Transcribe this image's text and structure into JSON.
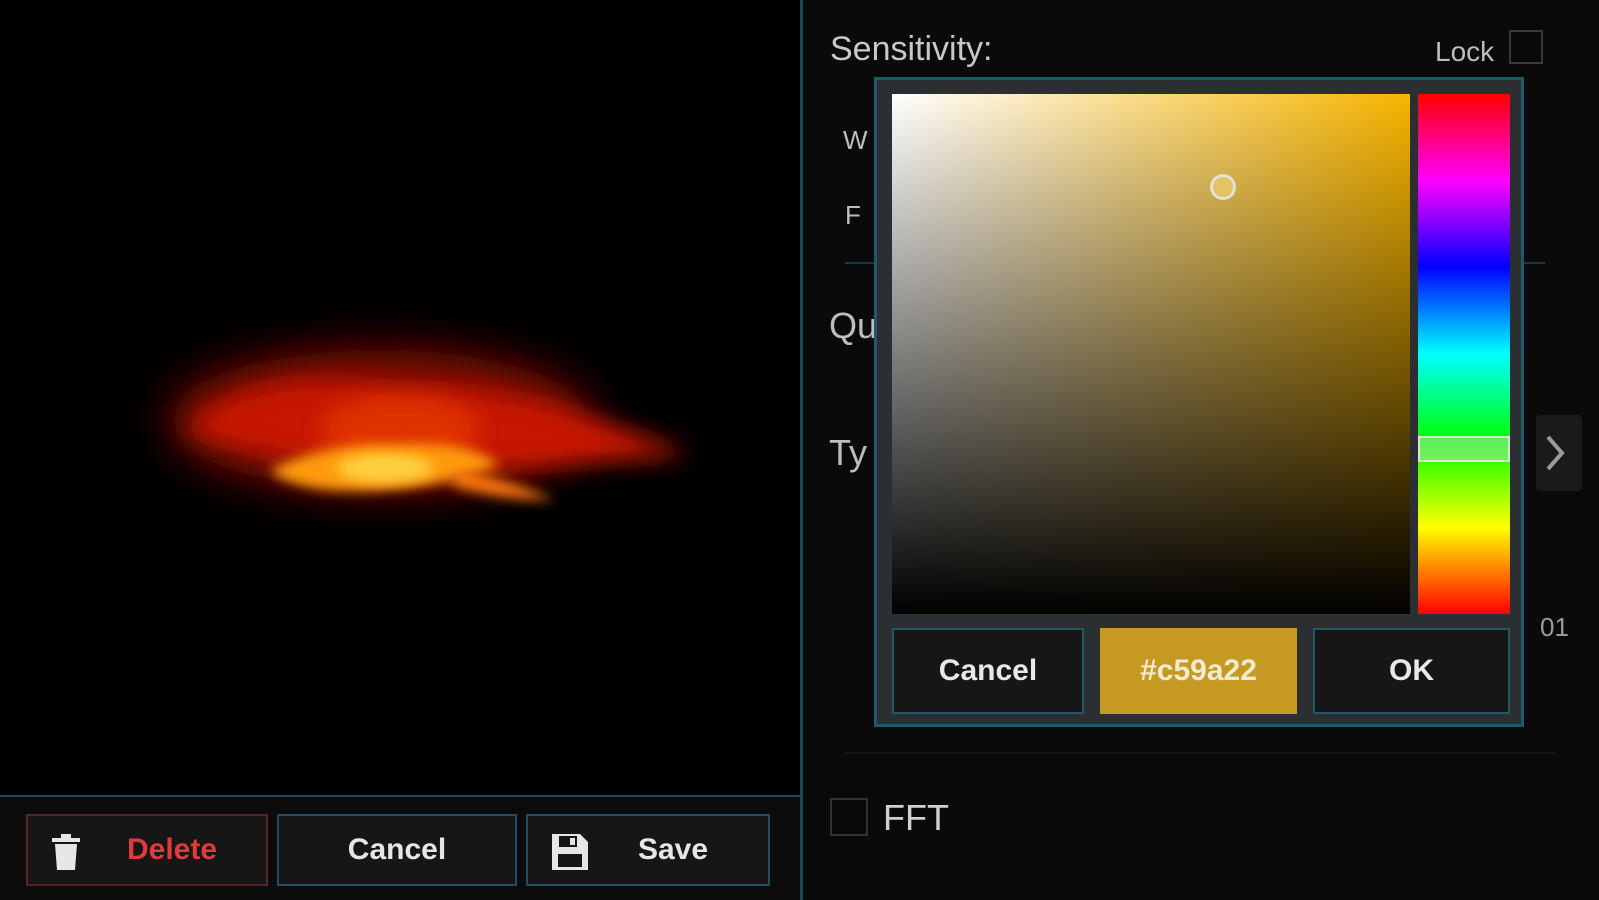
{
  "bottom_bar": {
    "delete_label": "Delete",
    "cancel_label": "Cancel",
    "save_label": "Save",
    "delete_icon": "trash-icon",
    "save_icon": "floppy-disk-icon"
  },
  "settings": {
    "sensitivity_label": "Sensitivity:",
    "lock_label": "Lock",
    "peek_w": "W",
    "peek_f": "F",
    "peek_q": "Qu",
    "peek_t": "Ty",
    "peek_num": "01",
    "fft_label": "FFT"
  },
  "color_picker": {
    "cancel_label": "Cancel",
    "hex_value": "#c59a22",
    "ok_label": "OK",
    "selected_color": "#c59a22",
    "hue_color": "#f7b500"
  },
  "colors": {
    "accent": "#1f5a6a",
    "danger": "#e03a3a",
    "selected": "#c59a22"
  }
}
